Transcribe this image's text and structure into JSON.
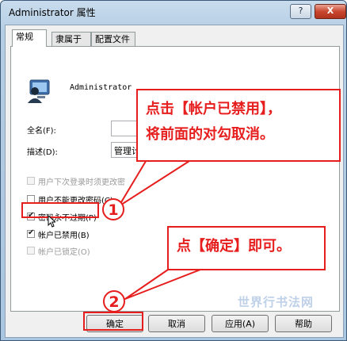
{
  "window": {
    "title": "Administrator 属性",
    "help_label": "?",
    "close_label": "X"
  },
  "tabs": [
    {
      "label": "常规",
      "active": true
    },
    {
      "label": "隶属于",
      "active": false
    },
    {
      "label": "配置文件",
      "active": false
    }
  ],
  "user": {
    "name": "Administrator"
  },
  "fields": {
    "fullname_label": "全名(F):",
    "fullname_value": "",
    "description_label": "描述(D):",
    "description_value": "管理计"
  },
  "checkboxes": [
    {
      "label": "用户下次登录时须更改密",
      "checked": false,
      "disabled": true
    },
    {
      "label": "用户不能更改密码(C)",
      "checked": false,
      "disabled": false
    },
    {
      "label": "密码永不过期(P)",
      "checked": true,
      "disabled": false
    },
    {
      "label": "帐户已禁用(B)",
      "checked": true,
      "disabled": false
    },
    {
      "label": "帐户已锁定(O)",
      "checked": false,
      "disabled": true
    }
  ],
  "buttons": {
    "ok": "确定",
    "cancel": "取消",
    "apply": "应用(A)",
    "help": "帮助"
  },
  "annotations": {
    "step1_number": "1",
    "step1_line1": "点击【帐户已禁用】，",
    "step1_line2": "将前面的对勾取消。",
    "step2_number": "2",
    "step2_text": "点【确定】即可。",
    "watermark": "世界行书法网",
    "color": "#e61e1e"
  }
}
